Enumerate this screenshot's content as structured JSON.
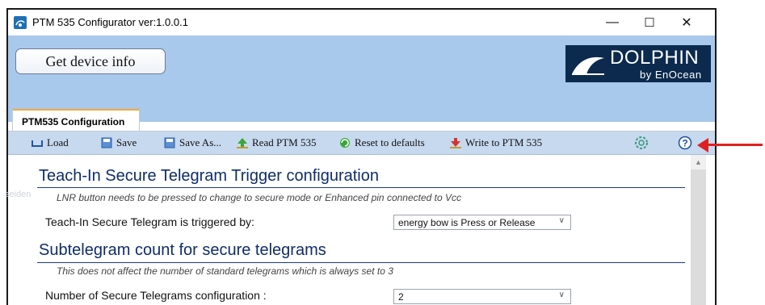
{
  "window": {
    "title": "PTM 535 Configurator ver:1.0.0.1",
    "minimize": "—",
    "maximize": "☐",
    "close": "✕"
  },
  "header": {
    "get_device_info": "Get device info",
    "logo_main": "DOLPHIN",
    "logo_sub": "by EnOcean"
  },
  "tab": {
    "label": "PTM535 Configuration"
  },
  "toolbar": {
    "load": "Load",
    "save": "Save",
    "save_as": "Save As...",
    "read": "Read PTM 535",
    "reset": "Reset to defaults",
    "write": "Write to PTM 535",
    "settings_icon": "gear-icon",
    "help_icon": "help-icon"
  },
  "content": {
    "ghost_text": "seiden",
    "section1": {
      "title": "Teach-In Secure Telegram Trigger configuration",
      "note": "LNR button needs to be pressed to change to secure mode or Enhanced pin connected to Vcc",
      "label": "Teach-In Secure Telegram is triggered by:",
      "value": "energy bow is Press or Release"
    },
    "section2": {
      "title": "Subtelegram count for secure telegrams",
      "note": "This does not affect the number of standard telegrams which is always set to 3",
      "label": "Number of Secure Telegrams configuration :",
      "value": "2"
    }
  },
  "colors": {
    "header_bg": "#a8c8ec",
    "toolbar_bg": "#c7d9ef",
    "section_title": "#0f2d6b",
    "tab_accent": "#f2a93b",
    "annotation_arrow": "#e02020"
  }
}
